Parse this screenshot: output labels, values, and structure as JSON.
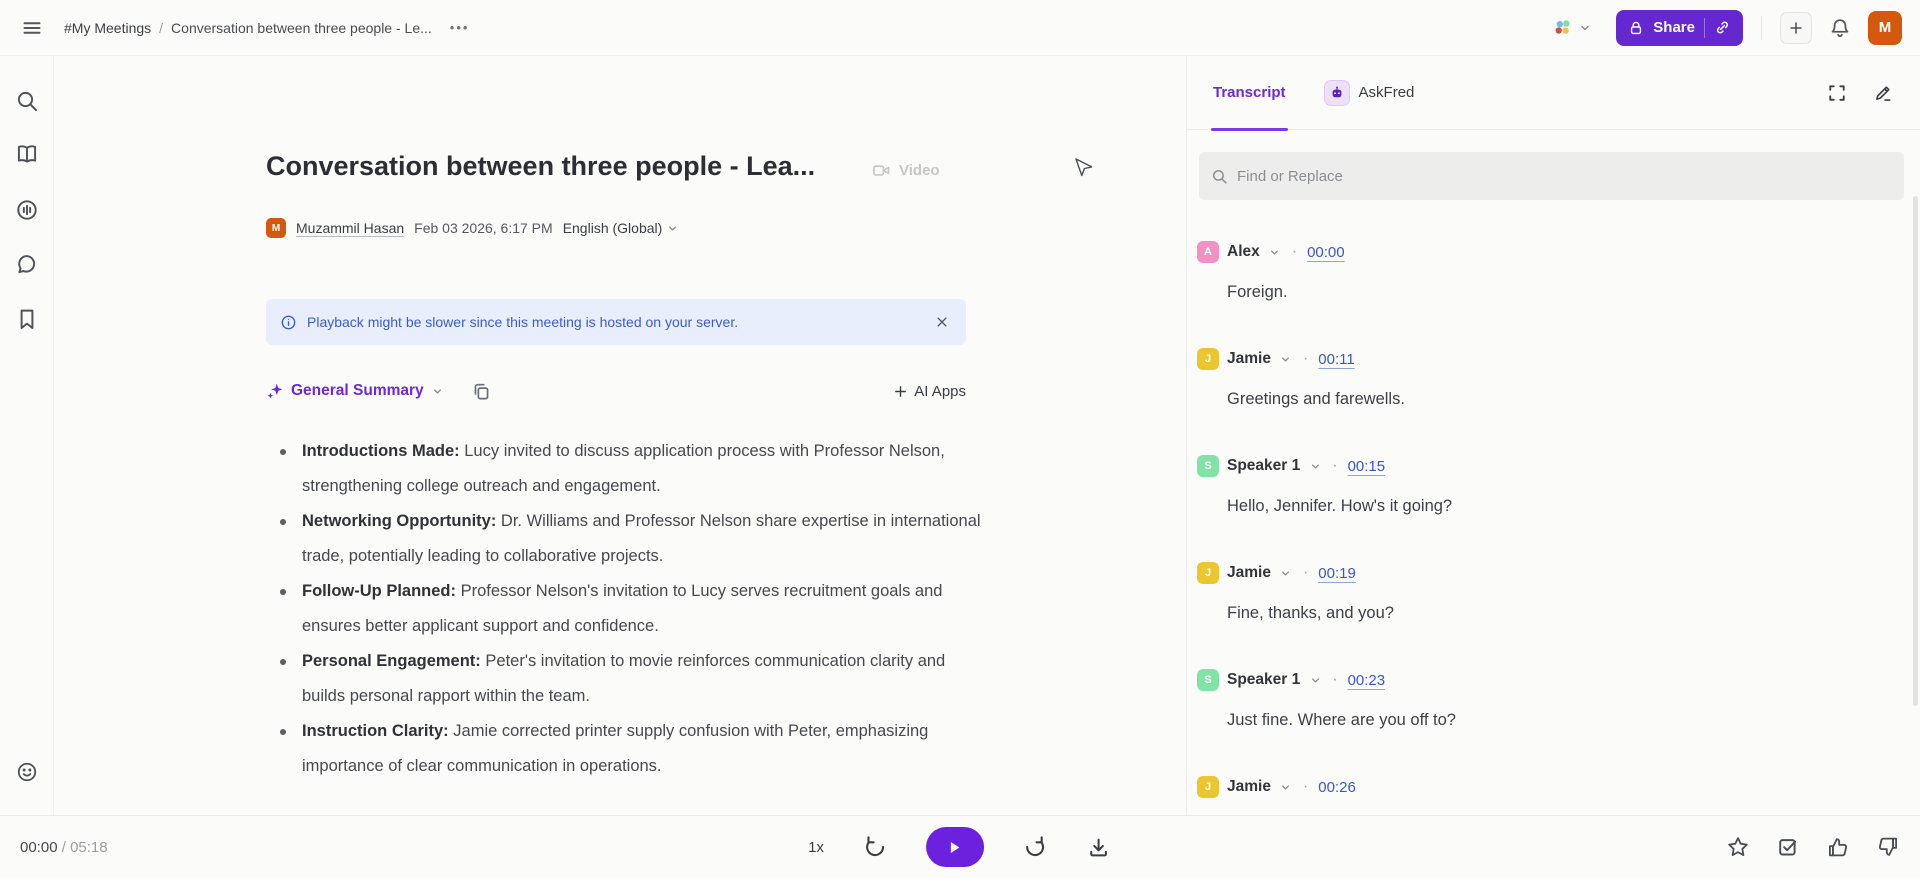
{
  "topbar": {
    "breadcrumb_root": "#My Meetings",
    "breadcrumb_sep": "/",
    "breadcrumb_current": "Conversation between three people - Le...",
    "more_label": "•••",
    "share_label": "Share",
    "avatar_initial": "M"
  },
  "main": {
    "title": "Conversation between three people - Lea...",
    "video_label": "Video",
    "owner_name": "Muzammil Hasan",
    "owner_initial": "M",
    "meeting_datetime": "Feb 03 2026, 6:17 PM",
    "language": "English (Global)",
    "banner_text": "Playback might be slower since this meeting is hosted on your server.",
    "summary_select": "General Summary",
    "ai_apps_label": "AI Apps",
    "bullets": [
      {
        "label": "Introductions Made:",
        "text": " Lucy invited to discuss application process with Professor Nelson, strengthening college outreach and engagement."
      },
      {
        "label": "Networking Opportunity:",
        "text": " Dr. Williams and Professor Nelson share expertise in international trade, potentially leading to collaborative projects."
      },
      {
        "label": "Follow-Up Planned:",
        "text": " Professor Nelson's invitation to Lucy serves recruitment goals and ensures better applicant support and confidence."
      },
      {
        "label": "Personal Engagement:",
        "text": " Peter's invitation to movie reinforces communication clarity and builds personal rapport within the team."
      },
      {
        "label": "Instruction Clarity:",
        "text": " Jamie corrected printer supply confusion with Peter, emphasizing importance of clear communication in operations."
      }
    ]
  },
  "player": {
    "current_time": "00:00",
    "separator": "/",
    "total_time": "05:18",
    "speed": "1x"
  },
  "panel": {
    "tab_transcript": "Transcript",
    "tab_askfred": "AskFred",
    "search_placeholder": "Find or Replace",
    "dot": "·",
    "entries": [
      {
        "speaker": "Alex",
        "avatar": "A",
        "color": "#f191c4",
        "time": "00:00",
        "text": "Foreign."
      },
      {
        "speaker": "Jamie",
        "avatar": "J",
        "color": "#ecc630",
        "time": "00:11",
        "text": "Greetings and farewells."
      },
      {
        "speaker": "Speaker 1",
        "avatar": "S",
        "color": "#82e3a6",
        "time": "00:15",
        "text": "Hello, Jennifer. How's it going?"
      },
      {
        "speaker": "Jamie",
        "avatar": "J",
        "color": "#ecc630",
        "time": "00:19",
        "text": "Fine, thanks, and you?"
      },
      {
        "speaker": "Speaker 1",
        "avatar": "S",
        "color": "#82e3a6",
        "time": "00:23",
        "text": "Just fine. Where are you off to?"
      },
      {
        "speaker": "Jamie",
        "avatar": "J",
        "color": "#ecc630",
        "time": "00:26",
        "text": ""
      }
    ]
  },
  "colors": {
    "accent_purple": "#6527cf",
    "tab_purple": "#6d28d9",
    "play_purple": "#6b21dd",
    "link_blue": "#3a57c4",
    "banner_bg": "#e8eefb",
    "banner_text": "#3e5cc9",
    "owner_avatar": "#d4590e"
  }
}
